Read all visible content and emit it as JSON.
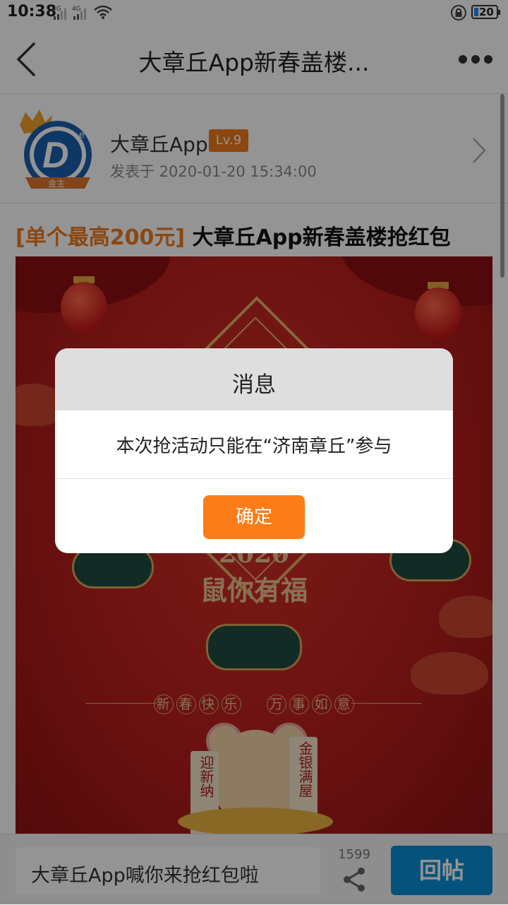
{
  "status_bar": {
    "time": "10:38",
    "signal_1_label": "4G",
    "signal_2_label": "4G",
    "battery_level": "20"
  },
  "nav": {
    "title": "大章丘App新春盖楼..."
  },
  "author": {
    "name": "大章丘App",
    "level": "Lv.9",
    "avatar_badge": "金主",
    "posted_at": "发表于 2020-01-20 15:34:00"
  },
  "post": {
    "title_tag": "[单个最高200元]",
    "title_text": " 大章丘App新春盖楼抢红包"
  },
  "banner": {
    "year": "2020",
    "blessing": "鼠你有福",
    "greeting_left": [
      "新",
      "春",
      "快",
      "乐"
    ],
    "greeting_right": [
      "万",
      "事",
      "如",
      "意"
    ],
    "scroll_left": "迎新纳",
    "scroll_right": "金银满屋"
  },
  "bottom_bar": {
    "reply_placeholder": "大章丘App喊你来抢红包啦",
    "share_count": "1599",
    "reply_button": "回帖"
  },
  "dialog": {
    "title": "消息",
    "message": "本次抢活动只能在“济南章丘”参与",
    "confirm": "确定"
  },
  "colors": {
    "accent_orange": "#fc7d17",
    "reply_blue": "#0a8fd8",
    "banner_red": "#b51d1c"
  }
}
